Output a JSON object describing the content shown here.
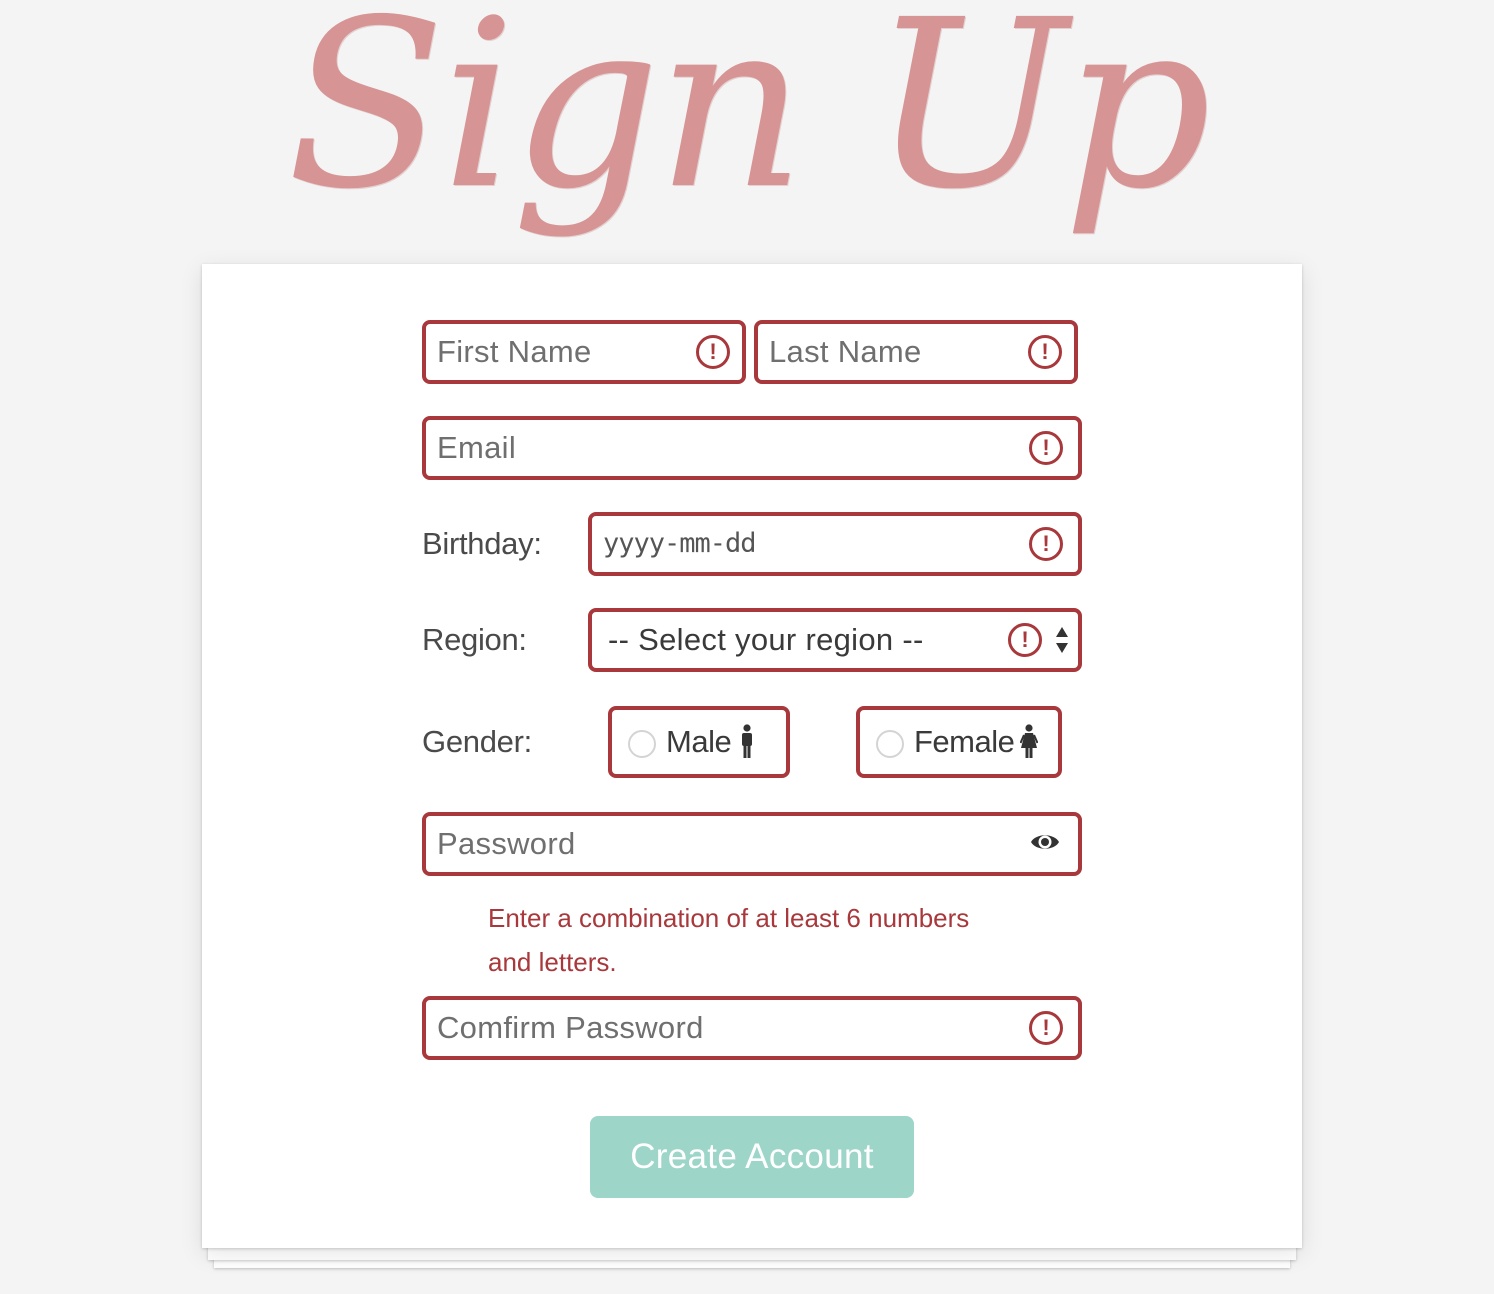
{
  "page": {
    "title": "Sign Up"
  },
  "form": {
    "first_name": {
      "placeholder": "First Name"
    },
    "last_name": {
      "placeholder": "Last Name"
    },
    "email": {
      "placeholder": "Email"
    },
    "birthday": {
      "label": "Birthday:",
      "placeholder": "yyyy-mm-dd"
    },
    "region": {
      "label": "Region:",
      "selected": "-- Select your region --"
    },
    "gender": {
      "label": "Gender:",
      "options": [
        {
          "label": "Male",
          "icon": "male-icon"
        },
        {
          "label": "Female",
          "icon": "female-icon"
        }
      ]
    },
    "password": {
      "placeholder": "Password",
      "error_line1": "Enter a combination of at least 6 numbers",
      "error_line2": "and letters."
    },
    "confirm_password": {
      "placeholder": "Comfirm Password"
    },
    "submit_label": "Create Account",
    "alert_glyph": "!"
  },
  "colors": {
    "background": "#f4f4f4",
    "title": "#d79494",
    "error": "#a8383b",
    "button": "#9dd6c8",
    "button_text": "#ffffff"
  }
}
